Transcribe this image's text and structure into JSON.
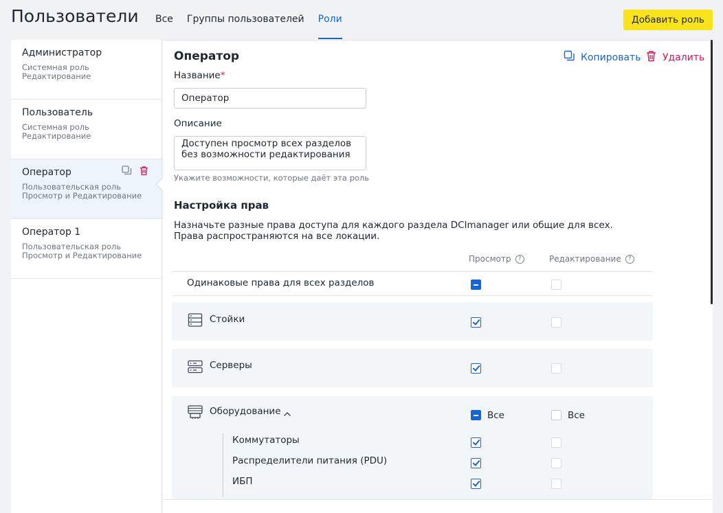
{
  "header": {
    "title": "Пользователи",
    "tabs": [
      {
        "label": "Все"
      },
      {
        "label": "Группы пользователей"
      },
      {
        "label": "Роли"
      }
    ],
    "add_button": "Добавить роль"
  },
  "roles": [
    {
      "name": "Администратор",
      "type": "Системная роль",
      "access": "Редактирование"
    },
    {
      "name": "Пользователь",
      "type": "Системная роль",
      "access": "Редактирование"
    },
    {
      "name": "Оператор",
      "type": "Пользовательская роль",
      "access": "Просмотр и Редактирование"
    },
    {
      "name": "Оператор 1",
      "type": "Пользовательская роль",
      "access": "Просмотр и Редактирование"
    }
  ],
  "detail": {
    "title": "Оператор",
    "copy_label": "Копировать",
    "delete_label": "Удалить",
    "name_label": "Название",
    "name_required_mark": "*",
    "name_value": "Оператор",
    "description_label": "Описание",
    "description_value": "Доступен просмотр всех разделов без возможности редактирования",
    "description_hint": "Укажите возможности, которые даёт эта роль",
    "rights_title": "Настройка прав",
    "rights_desc_line1": "Назначьте разные права доступа для каждого раздела DCImanager или общие для всех.",
    "rights_desc_line2": "Права распространяются на все локации.",
    "col_view": "Просмотр",
    "col_edit": "Редактирование",
    "same_rights_label": "Одинаковые права для всех разделов",
    "sections": [
      {
        "label": "Стойки",
        "icon": "rack-icon",
        "view": "checked",
        "edit": "unchecked"
      },
      {
        "label": "Серверы",
        "icon": "server-icon",
        "view": "checked",
        "edit": "unchecked"
      },
      {
        "label": "Оборудование",
        "icon": "equipment-icon",
        "view": "mixed",
        "edit": "unchecked",
        "all_label": "Все"
      }
    ],
    "equipment_items": [
      {
        "label": "Коммутаторы",
        "view": "checked",
        "edit": "unchecked"
      },
      {
        "label": "Распределители питания (PDU)",
        "view": "checked",
        "edit": "unchecked"
      },
      {
        "label": "ИБП",
        "view": "checked",
        "edit": "unchecked"
      }
    ]
  },
  "colors": {
    "accent": "#1565d8",
    "danger": "#d4145a",
    "primary_button": "#f8e31c"
  }
}
